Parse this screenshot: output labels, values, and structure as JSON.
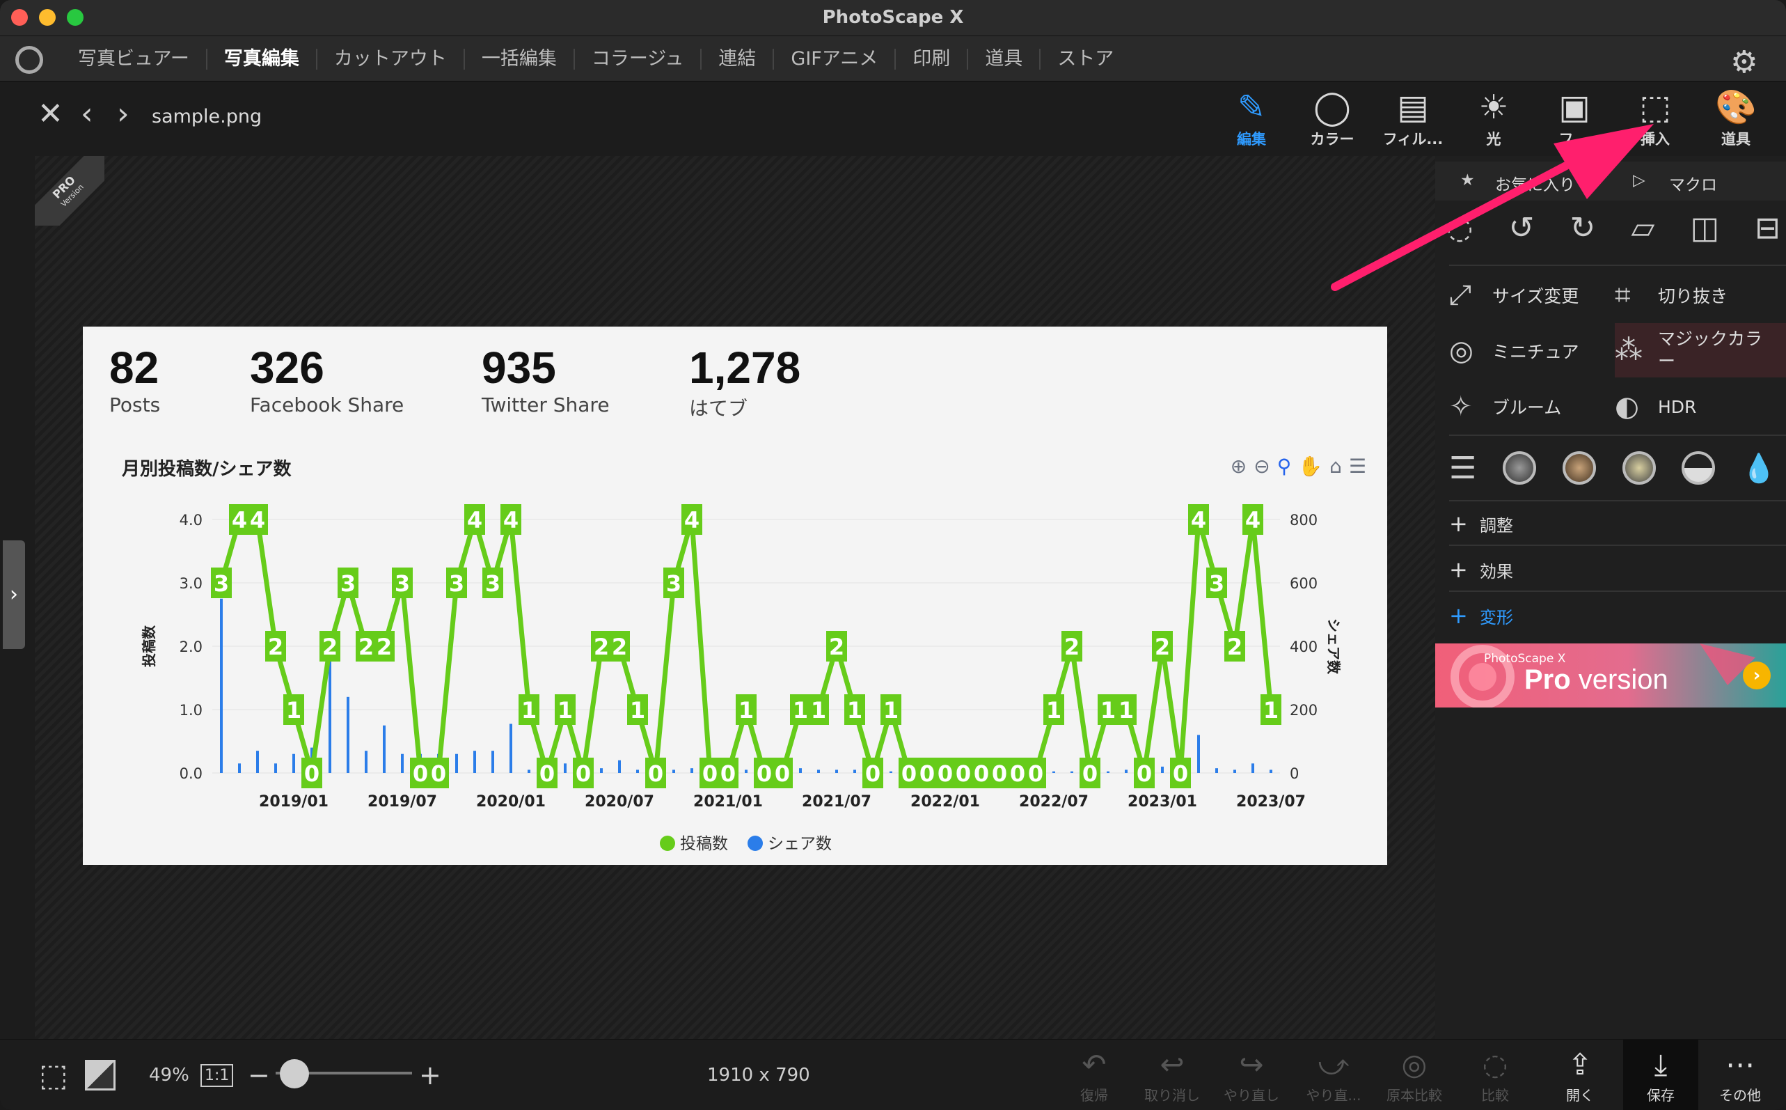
{
  "window": {
    "title": "PhotoScape X"
  },
  "menu": [
    "写真ビュアー",
    "写真編集",
    "カットアウト",
    "一括編集",
    "コラージュ",
    "連結",
    "GIFアニメ",
    "印刷",
    "道具",
    "ストア"
  ],
  "menu_active": "写真編集",
  "file": {
    "name": "sample.png"
  },
  "badge": {
    "pro": "PRO",
    "version": "Version"
  },
  "toolbar": [
    {
      "label": "編集",
      "icon": "edit-icon",
      "active": true
    },
    {
      "label": "カラー",
      "icon": "color-circle-icon"
    },
    {
      "label": "フィル...",
      "icon": "film-icon"
    },
    {
      "label": "光",
      "icon": "sun-icon"
    },
    {
      "label": "フ...",
      "icon": "frame-icon"
    },
    {
      "label": "挿入",
      "icon": "insert-star-icon"
    },
    {
      "label": "道具",
      "icon": "palette-icon"
    }
  ],
  "panel": {
    "tab_favorites": "お気に入り",
    "tab_macro": "マクロ",
    "features": [
      {
        "label": "サイズ変更",
        "icon": "resize-icon"
      },
      {
        "label": "切り抜き",
        "icon": "crop-icon"
      },
      {
        "label": "ミニチュア",
        "icon": "miniature-icon"
      },
      {
        "label": "マジックカラー",
        "icon": "magic-wand-icon"
      },
      {
        "label": "ブルーム",
        "icon": "bloom-icon"
      },
      {
        "label": "HDR",
        "icon": "hdr-icon"
      }
    ],
    "sections": [
      "調整",
      "効果",
      "変形"
    ],
    "promo_small": "PhotoScape X",
    "promo_pro": "Pro",
    "promo_version": " version",
    "promo_go": "›"
  },
  "stats": [
    {
      "value": "82",
      "label": "Posts"
    },
    {
      "value": "326",
      "label": "Facebook Share"
    },
    {
      "value": "935",
      "label": "Twitter Share"
    },
    {
      "value": "1,278",
      "label": "はてブ"
    }
  ],
  "chart_data": {
    "type": "line",
    "title": "月別投稿数/シェア数",
    "ylabel": "投稿数",
    "y2label": "シェア数",
    "ylim": [
      0,
      4
    ],
    "y2lim": [
      0,
      800
    ],
    "yticks": [
      "0.0",
      "1.0",
      "2.0",
      "3.0",
      "4.0"
    ],
    "y2ticks": [
      "0",
      "200",
      "400",
      "600",
      "800"
    ],
    "xticks": [
      {
        "label": "2019/01",
        "i": 4
      },
      {
        "label": "2019/07",
        "i": 10
      },
      {
        "label": "2020/01",
        "i": 16
      },
      {
        "label": "2020/07",
        "i": 22
      },
      {
        "label": "2021/01",
        "i": 28
      },
      {
        "label": "2021/07",
        "i": 34
      },
      {
        "label": "2022/01",
        "i": 40
      },
      {
        "label": "2022/07",
        "i": 46
      },
      {
        "label": "2023/01",
        "i": 52
      },
      {
        "label": "2023/07",
        "i": 58
      }
    ],
    "start": "2018/09",
    "legend": [
      {
        "name": "投稿数",
        "color": "#66cc1a"
      },
      {
        "name": "シェア数",
        "color": "#2b7de9"
      }
    ],
    "series": [
      {
        "name": "投稿数",
        "values": [
          3,
          4,
          4,
          2,
          1,
          0,
          2,
          3,
          2,
          2,
          3,
          0,
          0,
          3,
          4,
          3,
          4,
          1,
          0,
          1,
          0,
          2,
          2,
          1,
          0,
          3,
          4,
          0,
          0,
          1,
          0,
          0,
          1,
          1,
          2,
          1,
          0,
          1,
          0,
          0,
          0,
          0,
          0,
          0,
          0,
          0,
          1,
          2,
          0,
          1,
          1,
          0,
          2,
          0,
          4,
          3,
          2,
          4,
          1
        ]
      },
      {
        "name": "シェア数",
        "values": [
          550,
          30,
          70,
          30,
          60,
          80,
          360,
          240,
          70,
          150,
          60,
          60,
          60,
          60,
          70,
          70,
          155,
          10,
          40,
          30,
          20,
          15,
          40,
          10,
          5,
          10,
          15,
          25,
          20,
          10,
          10,
          10,
          15,
          10,
          10,
          10,
          10,
          5,
          5,
          5,
          5,
          5,
          5,
          5,
          5,
          5,
          5,
          5,
          5,
          5,
          10,
          5,
          20,
          20,
          120,
          15,
          10,
          30,
          10
        ]
      }
    ]
  },
  "bottom": {
    "zoom": "49%",
    "one_to_one": "1:1",
    "dimensions": "1910 x 790",
    "buttons": [
      {
        "label": "復帰",
        "icon": "revert-icon"
      },
      {
        "label": "取り消し",
        "icon": "undo-icon"
      },
      {
        "label": "やり直し",
        "icon": "redo-icon"
      },
      {
        "label": "やり直...",
        "icon": "redo-all-icon"
      },
      {
        "label": "原本比較",
        "icon": "compare-original-icon"
      },
      {
        "label": "比較",
        "icon": "compare-icon"
      },
      {
        "label": "開く",
        "icon": "open-share-icon"
      },
      {
        "label": "保存",
        "icon": "save-download-icon"
      },
      {
        "label": "その他",
        "icon": "more-icon"
      }
    ]
  },
  "colors": {
    "accent": "#2f9bff",
    "line": "#66cc1a",
    "bar": "#2b7de9",
    "arrow": "#ff1f6d"
  }
}
